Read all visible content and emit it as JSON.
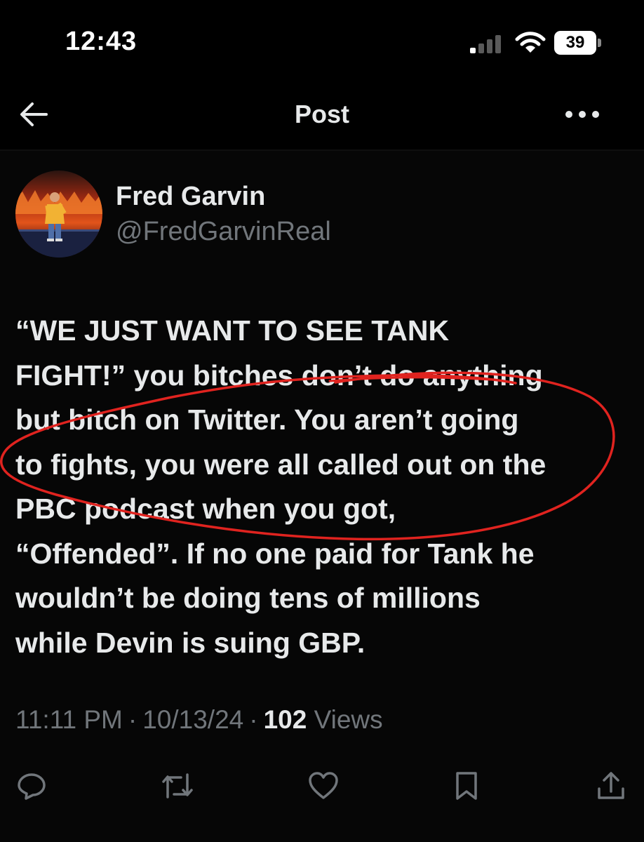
{
  "status_bar": {
    "time": "12:43",
    "battery_level": "39",
    "icons": [
      "cellular-signal-icon",
      "wifi-icon",
      "battery-icon"
    ]
  },
  "header": {
    "title": "Post",
    "back_icon": "arrow-left-icon",
    "more_icon": "ellipsis-icon"
  },
  "post": {
    "author": {
      "display_name": "Fred Garvin",
      "handle": "@FredGarvinReal"
    },
    "text_lines": [
      "“WE JUST WANT TO SEE TANK",
      "FIGHT!” you bitches don’t do anything",
      "but bitch on Twitter. You aren’t going",
      "to fights, you were all called out on the",
      "PBC podcast when you got,",
      "“Offended”. If no one paid for Tank he",
      "wouldn’t be doing tens of millions",
      "while Devin is suing GBP."
    ],
    "time": "11:11 PM",
    "date": "10/13/24",
    "separator": "·",
    "views_count": "102",
    "views_label": "Views"
  },
  "actions": [
    {
      "name": "reply",
      "icon": "reply-icon"
    },
    {
      "name": "repost",
      "icon": "repost-icon"
    },
    {
      "name": "like",
      "icon": "heart-icon"
    },
    {
      "name": "bookmark",
      "icon": "bookmark-icon"
    },
    {
      "name": "share",
      "icon": "share-icon"
    }
  ],
  "colors": {
    "background": "#000000",
    "text_primary": "#e7e9ea",
    "text_secondary": "#71767b",
    "scribble_red": "#e0231f"
  }
}
